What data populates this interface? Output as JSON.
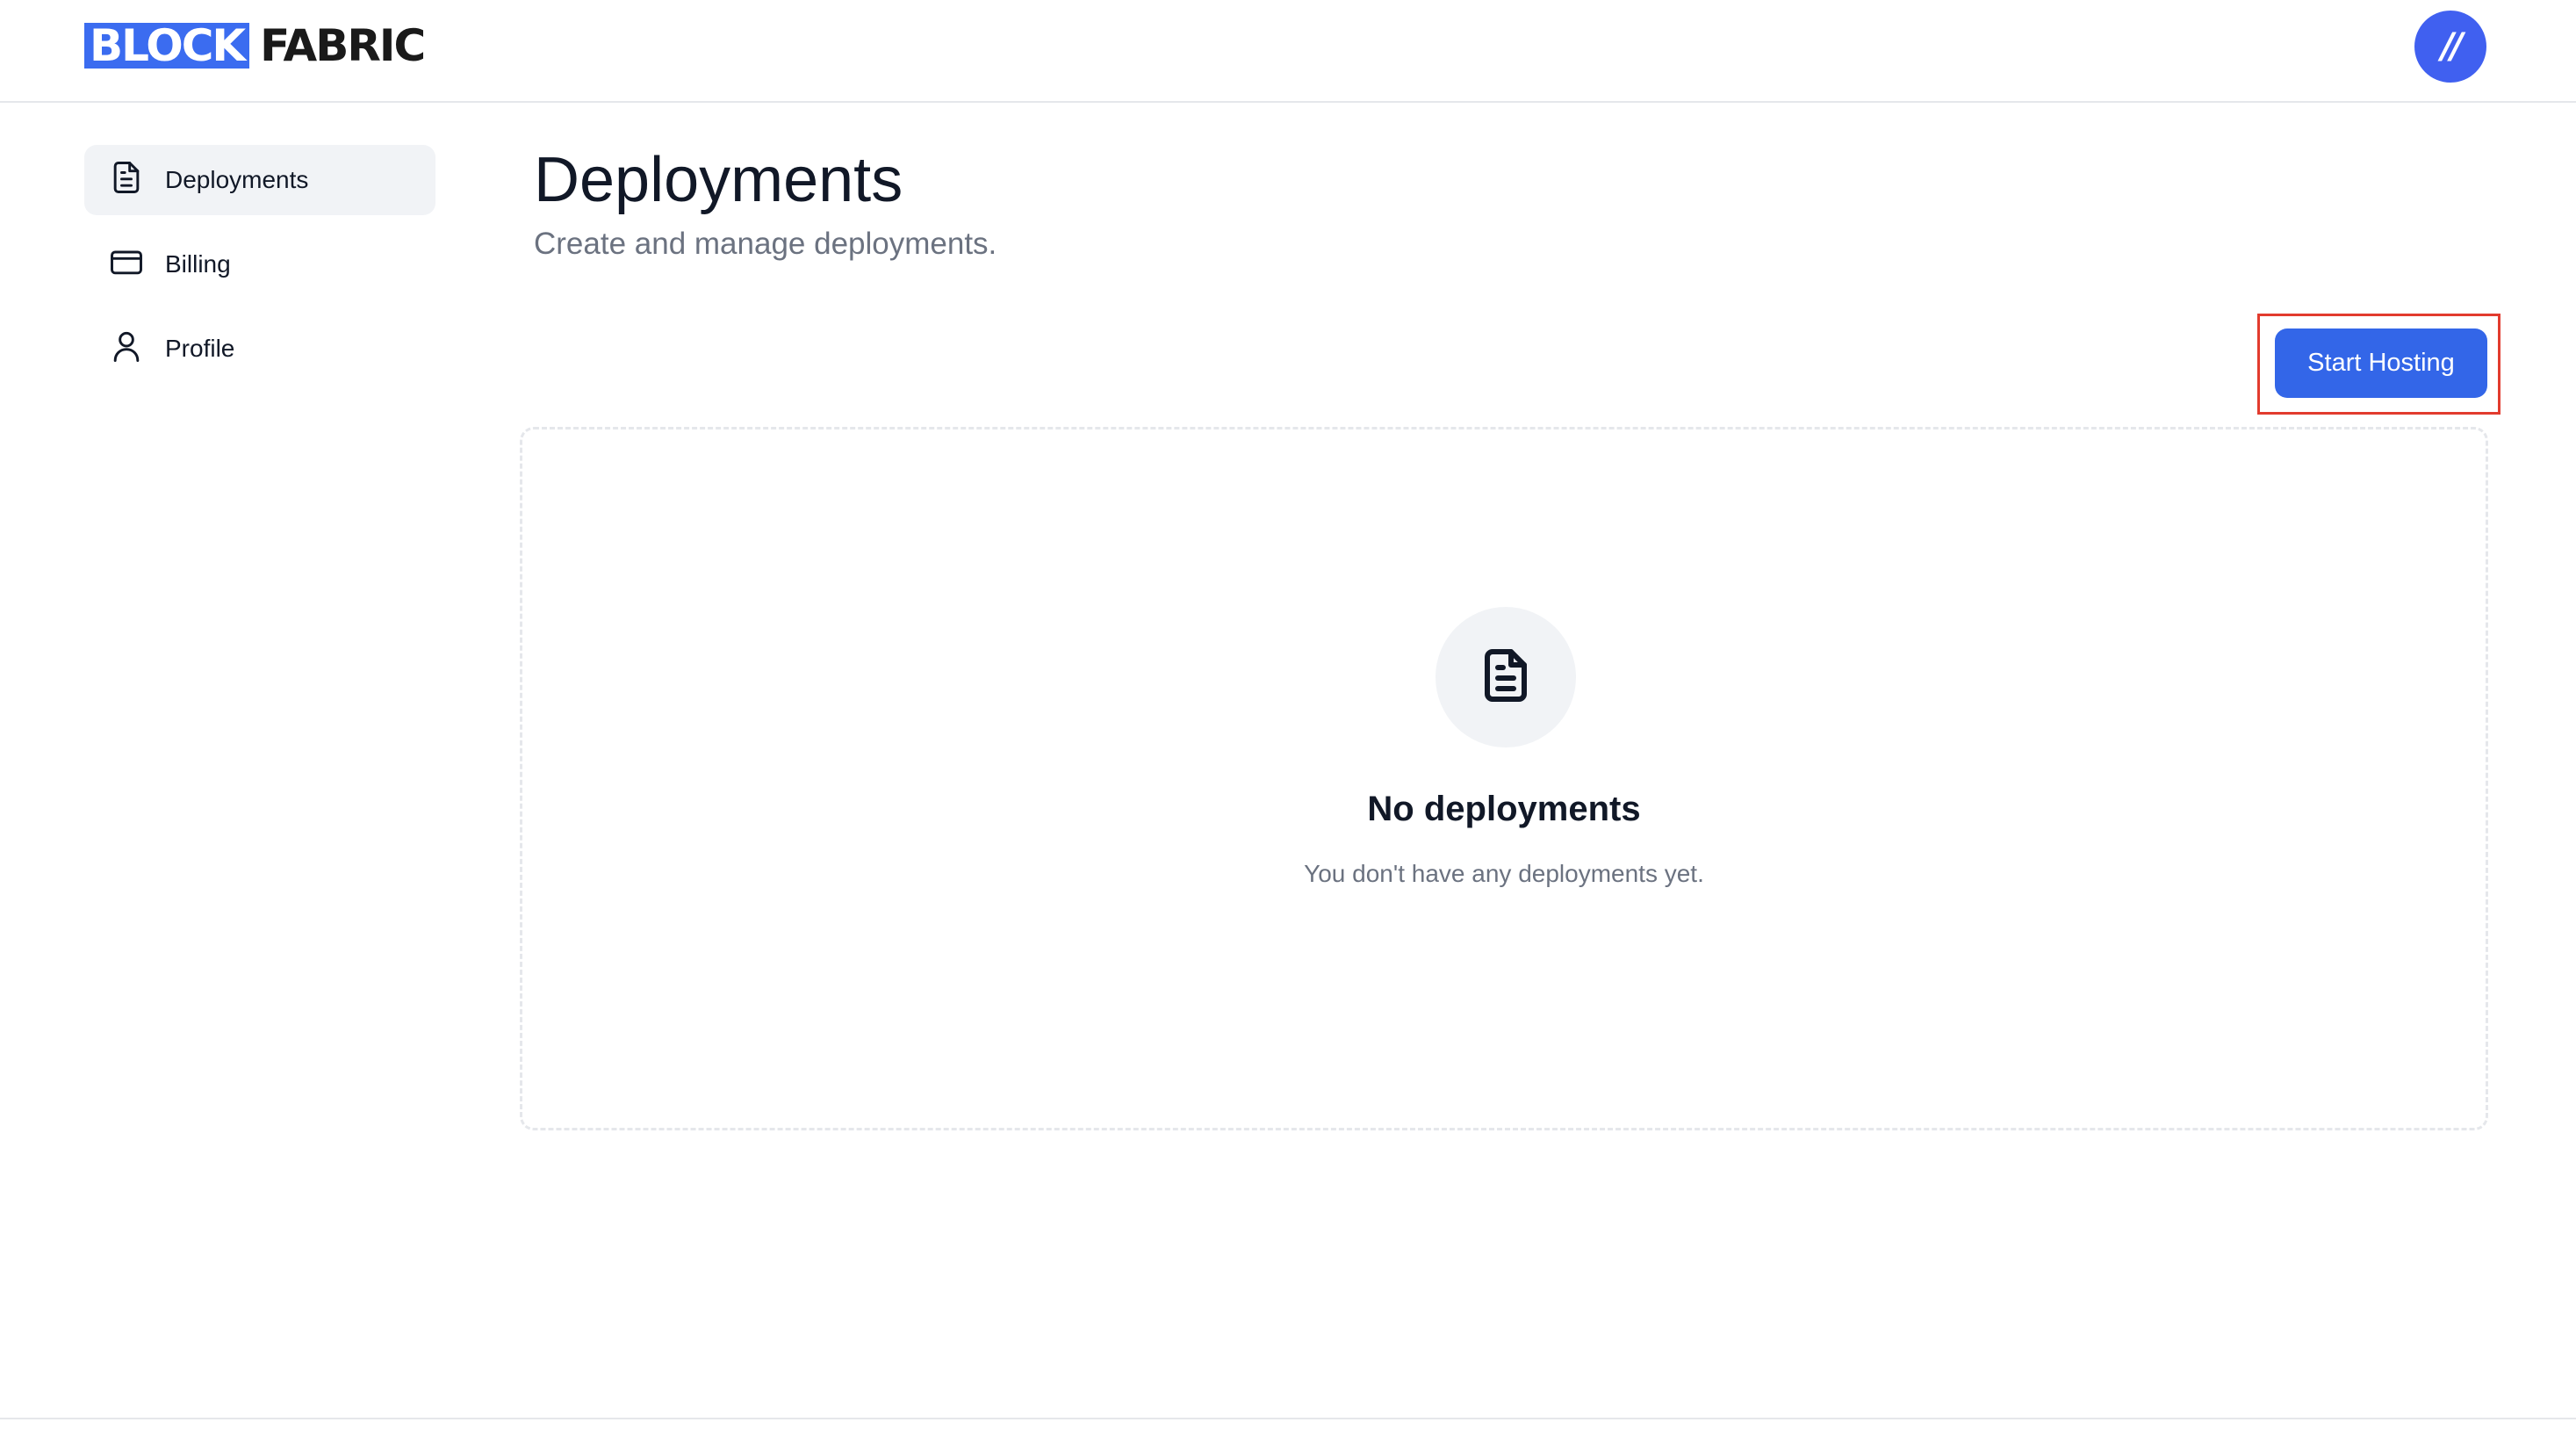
{
  "header": {
    "logo_block": "BLOCK",
    "logo_fabric": "FABRIC",
    "avatar_initials": "//",
    "brand_color": "#3b6cf0"
  },
  "sidebar": {
    "items": [
      {
        "label": "Deployments",
        "icon": "document-icon",
        "active": true
      },
      {
        "label": "Billing",
        "icon": "credit-card-icon",
        "active": false
      },
      {
        "label": "Profile",
        "icon": "user-icon",
        "active": false
      }
    ]
  },
  "main": {
    "title": "Deployments",
    "subtitle": "Create and manage deployments.",
    "primary_button": "Start Hosting",
    "primary_color": "#3366e8",
    "highlight_color": "#e23b2e",
    "empty_state": {
      "icon": "document-icon",
      "title": "No deployments",
      "text": "You don't have any deployments yet."
    }
  }
}
